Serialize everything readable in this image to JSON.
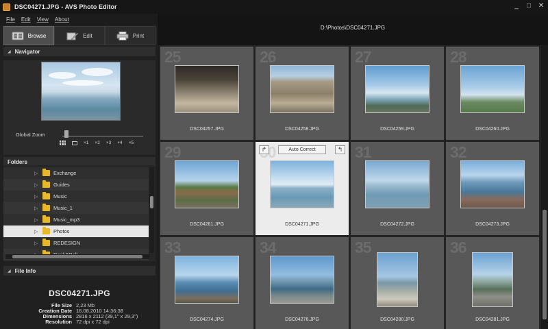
{
  "window": {
    "title": "DSC04271.JPG - AVS Photo Editor",
    "controls": [
      "minimize",
      "maximize",
      "close"
    ]
  },
  "menu": {
    "items": [
      "File",
      "Edit",
      "View",
      "About"
    ]
  },
  "path": "D:\\Photos\\DSC04271.JPG",
  "modes": {
    "browse": "Browse",
    "edit": "Edit",
    "print": "Print",
    "active": "browse"
  },
  "navigator": {
    "header": "Navigator",
    "zoom_label": "Global Zoom",
    "zoom_presets": [
      "×1",
      "×2",
      "×3",
      "×4",
      "×5"
    ],
    "zoom_level": 0.03
  },
  "folders": {
    "header": "Folders",
    "items": [
      {
        "label": "Exchange",
        "selected": false
      },
      {
        "label": "Guides",
        "selected": false
      },
      {
        "label": "Music",
        "selected": false
      },
      {
        "label": "Music_1",
        "selected": false
      },
      {
        "label": "Music_mp3",
        "selected": false
      },
      {
        "label": "Photos",
        "selected": true
      },
      {
        "label": "REDESIGN",
        "selected": false
      },
      {
        "label": "Rock&Roll",
        "selected": false
      }
    ]
  },
  "file_info": {
    "header": "File Info",
    "name": "DSC04271.JPG",
    "rows": [
      {
        "key": "File Size",
        "value": "2,23 Mb"
      },
      {
        "key": "Creation Date",
        "value": "16.08.2010  14:36:38"
      },
      {
        "key": "Dimensions",
        "value": "2816 x 2112 (39,1\" x 29,3\")"
      },
      {
        "key": "Resolution",
        "value": "72 dpi x 72 dpi"
      }
    ]
  },
  "grid": {
    "auto_correct_label": "Auto Correct",
    "cells": [
      {
        "num": "25",
        "file": "DSC04257.JPG",
        "photo": "ruins"
      },
      {
        "num": "26",
        "file": "DSC04258.JPG",
        "photo": "stone"
      },
      {
        "num": "27",
        "file": "DSC04259.JPG",
        "photo": "flags"
      },
      {
        "num": "28",
        "file": "DSC04260.JPG",
        "photo": "statue"
      },
      {
        "num": "29",
        "file": "DSC04261.JPG",
        "photo": "houses"
      },
      {
        "num": "30",
        "file": "DSC04271.JPG",
        "photo": "sea1",
        "selected": true
      },
      {
        "num": "31",
        "file": "DSC04272.JPG",
        "photo": "sea2"
      },
      {
        "num": "32",
        "file": "DSC04273.JPG",
        "photo": "rocks"
      },
      {
        "num": "33",
        "file": "DSC04274.JPG",
        "photo": "coast"
      },
      {
        "num": "34",
        "file": "DSC04276.JPG",
        "photo": "boats"
      },
      {
        "num": "35",
        "file": "DSC04280.JPG",
        "photo": "pier"
      },
      {
        "num": "36",
        "file": "DSC04281.JPG",
        "photo": "road"
      }
    ]
  },
  "colors": {
    "background": "#1c1c1c",
    "cell": "#585858",
    "cell_selected": "#ececec",
    "folder_icon": "#e7b82c"
  }
}
